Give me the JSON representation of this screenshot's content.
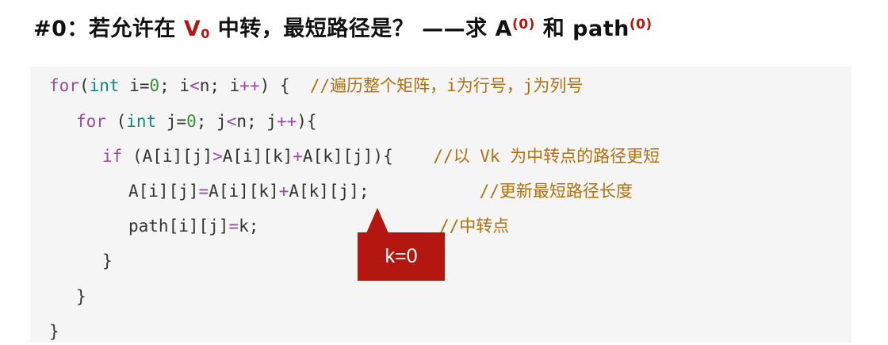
{
  "title": {
    "prefix": "#0：若允许在 ",
    "vertex": "V",
    "vertex_sub": "0",
    "middle": " 中转，最短路径是？ ——求 A",
    "a_sup": "(0)",
    "and": " 和 path",
    "path_sup": "(0)"
  },
  "code": {
    "l1": {
      "for": "for",
      "p1": "(",
      "int": "int",
      "p2": " i=",
      "zero": "0",
      "p3": "; i",
      "lt": "<",
      "p4": "n; i",
      "inc": "++",
      "p5": ") {  ",
      "comment": "//遍历整个矩阵，i为行号，j为列号"
    },
    "l2": {
      "for": "for",
      "p1": " (",
      "int": "int",
      "p2": " j=",
      "zero": "0",
      "p3": "; j",
      "lt": "<",
      "p4": "n; j",
      "inc": "++",
      "p5": "){"
    },
    "l3": {
      "if": "if",
      "p1": " (A[i][j]",
      "gt": ">",
      "p2": "A[i][k]",
      "plus": "+",
      "p3": "A[k][j]){    ",
      "comment": "//以 Vk 为中转点的路径更短"
    },
    "l4": {
      "p1": "A[i][j]",
      "eq": "=",
      "p2": "A[i][k]",
      "plus": "+",
      "p3": "A[k][j];           ",
      "comment": "//更新最短路径长度"
    },
    "l5": {
      "p1": "path[i][j]",
      "eq": "=",
      "p2": "k;                  ",
      "comment": "//中转点"
    },
    "l6": {
      "brace": "}"
    },
    "l7": {
      "brace": "}"
    },
    "l8": {
      "brace": "}"
    }
  },
  "callout": {
    "label": "k=0"
  },
  "colors": {
    "accent_red": "#b3170f",
    "keyword": "#9c4a9c",
    "type": "#0f8a7d",
    "number": "#3f8f39",
    "comment": "#b0700c",
    "code_bg": "#f5f5f5"
  }
}
